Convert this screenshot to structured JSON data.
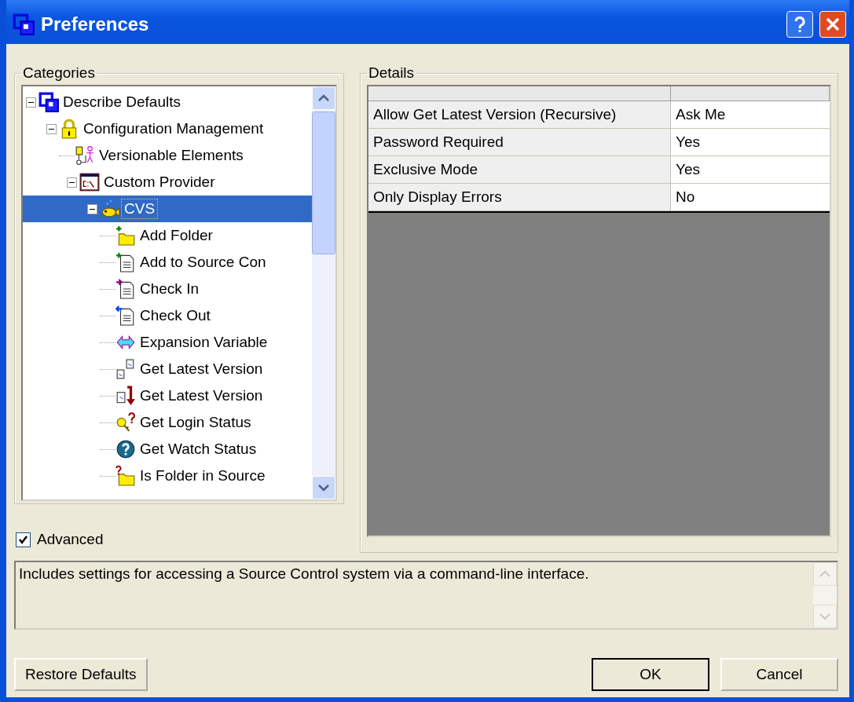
{
  "window": {
    "title": "Preferences"
  },
  "categories": {
    "label": "Categories",
    "tree": [
      {
        "label": "Describe Defaults",
        "expanded": true,
        "selected": false,
        "children": [
          {
            "label": "Configuration Management",
            "expanded": true,
            "selected": false,
            "children": [
              {
                "label": "Versionable Elements",
                "selected": false
              },
              {
                "label": "Custom Provider",
                "expanded": true,
                "selected": false,
                "children": [
                  {
                    "label": "CVS",
                    "expanded": true,
                    "selected": true,
                    "children": [
                      {
                        "label": "Add Folder",
                        "selected": false
                      },
                      {
                        "label": "Add to Source Con",
                        "selected": false
                      },
                      {
                        "label": "Check In",
                        "selected": false
                      },
                      {
                        "label": "Check Out",
                        "selected": false
                      },
                      {
                        "label": "Expansion Variable",
                        "selected": false
                      },
                      {
                        "label": "Get Latest Version",
                        "selected": false
                      },
                      {
                        "label": "Get Latest Version",
                        "selected": false
                      },
                      {
                        "label": "Get Login Status",
                        "selected": false
                      },
                      {
                        "label": "Get Watch Status",
                        "selected": false
                      },
                      {
                        "label": "Is Folder in Source",
                        "selected": false
                      }
                    ]
                  }
                ]
              }
            ]
          }
        ]
      }
    ]
  },
  "advanced": {
    "label": "Advanced",
    "checked": true
  },
  "details": {
    "label": "Details",
    "rows": [
      {
        "name": "Allow Get Latest Version (Recursive)",
        "value": "Ask Me"
      },
      {
        "name": "Password Required",
        "value": "Yes"
      },
      {
        "name": "Exclusive Mode",
        "value": "Yes"
      },
      {
        "name": "Only Display Errors",
        "value": "No"
      }
    ]
  },
  "description": "Includes settings for accessing a Source Control system via a command-line interface.",
  "buttons": {
    "restore": "Restore Defaults",
    "ok": "OK",
    "cancel": "Cancel"
  }
}
